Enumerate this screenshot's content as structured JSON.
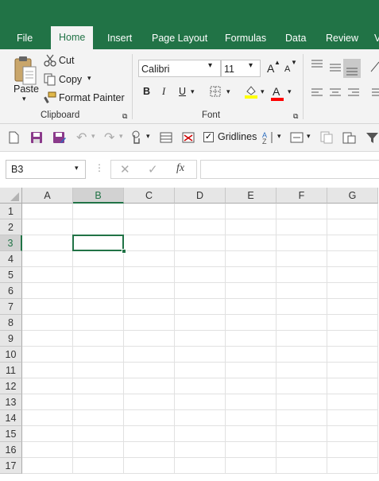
{
  "tabs": [
    "File",
    "Home",
    "Insert",
    "Page Layout",
    "Formulas",
    "Data",
    "Review",
    "V"
  ],
  "active_tab": "Home",
  "clipboard": {
    "paste_label": "Paste",
    "cut_label": "Cut",
    "copy_label": "Copy",
    "format_painter_label": "Format Painter",
    "group_label": "Clipboard"
  },
  "font": {
    "name": "Calibri",
    "size": "11",
    "group_label": "Font",
    "bold": "B",
    "italic": "I",
    "underline": "U",
    "grow": "A",
    "shrink": "A",
    "color_letter": "A"
  },
  "qat": {
    "gridlines_label": "Gridlines",
    "gridlines_checked": true
  },
  "formula_bar": {
    "name_box": "B3",
    "fx": "fx",
    "value": ""
  },
  "grid": {
    "columns": [
      "A",
      "B",
      "C",
      "D",
      "E",
      "F",
      "G"
    ],
    "rows": [
      "1",
      "2",
      "3",
      "4",
      "5",
      "6",
      "7",
      "8",
      "9",
      "10",
      "11",
      "12",
      "13",
      "14",
      "15",
      "16",
      "17"
    ],
    "selected_cell": "B3"
  },
  "colors": {
    "accent": "#217346",
    "fill_yellow": "#ffff00",
    "font_red": "#ff0000"
  }
}
